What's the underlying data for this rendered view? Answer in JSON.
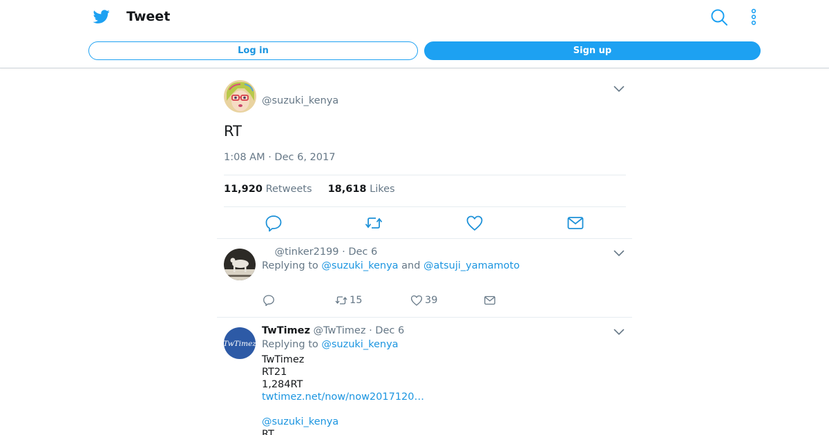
{
  "header": {
    "title": "Tweet",
    "login_label": "Log in",
    "signup_label": "Sign up",
    "icons": [
      "twitter-bird-icon",
      "search-icon",
      "more-vertical-icon"
    ],
    "accent_color": "#1da1f2"
  },
  "tweet": {
    "handle": "@suzuki_kenya",
    "text": "RT",
    "timestamp": "1:08 AM · Dec 6, 2017",
    "retweets_count": "11,920",
    "retweets_label": "Retweets",
    "likes_count": "18,618",
    "likes_label": "Likes",
    "actions": [
      "reply-icon",
      "retweet-icon",
      "like-icon",
      "share-mail-icon"
    ]
  },
  "replies": [
    {
      "name": "",
      "handle": "@tinker2199",
      "date": "· Dec 6",
      "replying_prefix": "Replying to",
      "replying_user1": "@suzuki_kenya",
      "replying_and": "and",
      "replying_user2": "@atsuji_yamamoto",
      "retweets": "15",
      "likes": "39"
    },
    {
      "name": "TwTimez",
      "handle": "@TwTimez",
      "date": "· Dec 6",
      "replying_prefix": "Replying to",
      "replying_user1": "@suzuki_kenya",
      "avatar_text": "TwTimez",
      "lines": [
        "TwTimez",
        "RT21",
        "1,284RT"
      ],
      "link": "twtimez.net/now/now2017120…",
      "mention": "@suzuki_kenya",
      "last_line": "RT"
    }
  ]
}
